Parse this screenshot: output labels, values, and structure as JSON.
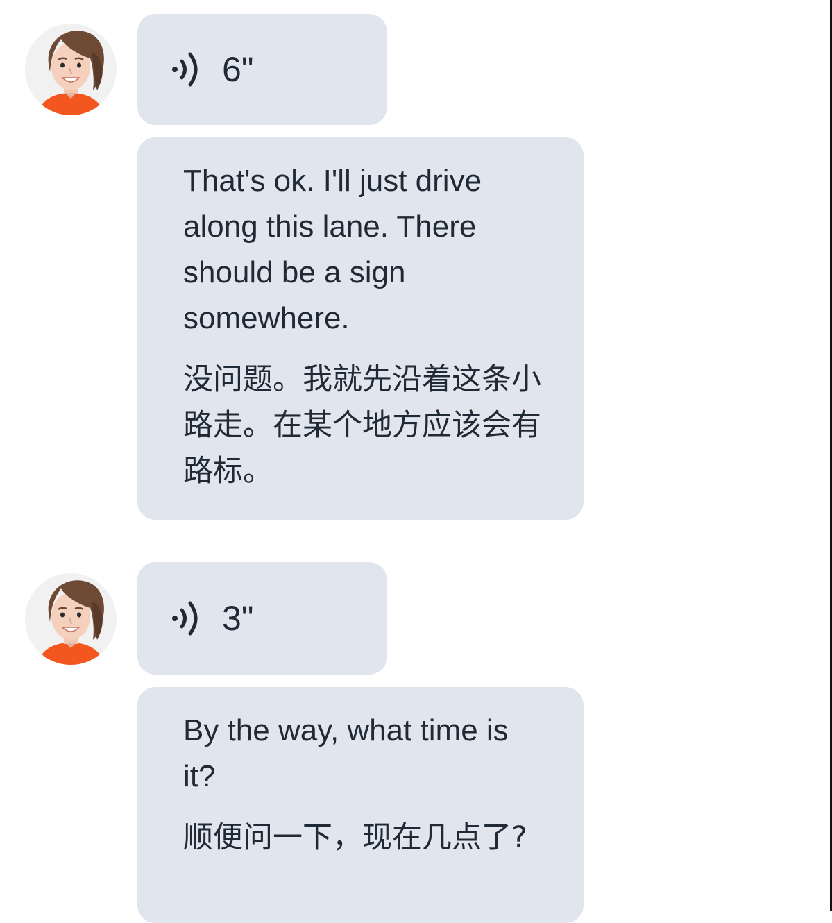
{
  "messages": [
    {
      "avatar": "woman-avatar-icon",
      "audio_duration": "6\"",
      "english": "That's ok. I'll just drive along this lane. There should be a sign somewhere.",
      "chinese": "没问题。我就先沿着这条小路走。在某个地方应该会有路标。"
    },
    {
      "avatar": "woman-avatar-icon",
      "audio_duration": "3\"",
      "english": "By the way, what time is it?",
      "chinese": "顺便问一下，现在几点了?"
    }
  ],
  "colors": {
    "bubble": "#e1e6ee",
    "text": "#1f2a36",
    "avatar_bg": "#f1f1f1",
    "shirt": "#f3561f",
    "hair": "#6e4a35"
  }
}
